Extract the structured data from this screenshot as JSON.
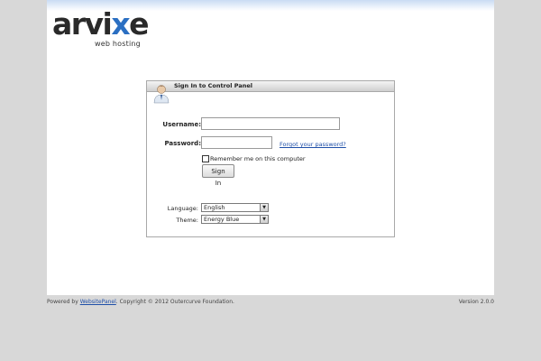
{
  "brand": {
    "logo_text_main": "arvi",
    "logo_text_x": "x",
    "logo_text_end": "e",
    "logo_sub": "web hosting"
  },
  "login_panel": {
    "title": "Sign In to Control Panel",
    "username_label": "Username:",
    "username_value": "",
    "password_label": "Password:",
    "password_value": "",
    "forgot_link": "Forgot your password?",
    "remember_label": "Remember me on this computer",
    "remember_checked": false,
    "sign_in_button": "Sign In",
    "language_label": "Language:",
    "language_value": "English",
    "theme_label": "Theme:",
    "theme_value": "Energy Blue"
  },
  "footer": {
    "powered_by": "Powered by ",
    "powered_link": "WebsitePanel",
    "copyright": ". Copyright © 2012 Outercurve Foundation.",
    "version": "Version 2.0.0"
  },
  "icons": {
    "user": "user-avatar-icon",
    "checkbox": "checkbox-icon",
    "dropdown": "chevron-down-icon"
  }
}
